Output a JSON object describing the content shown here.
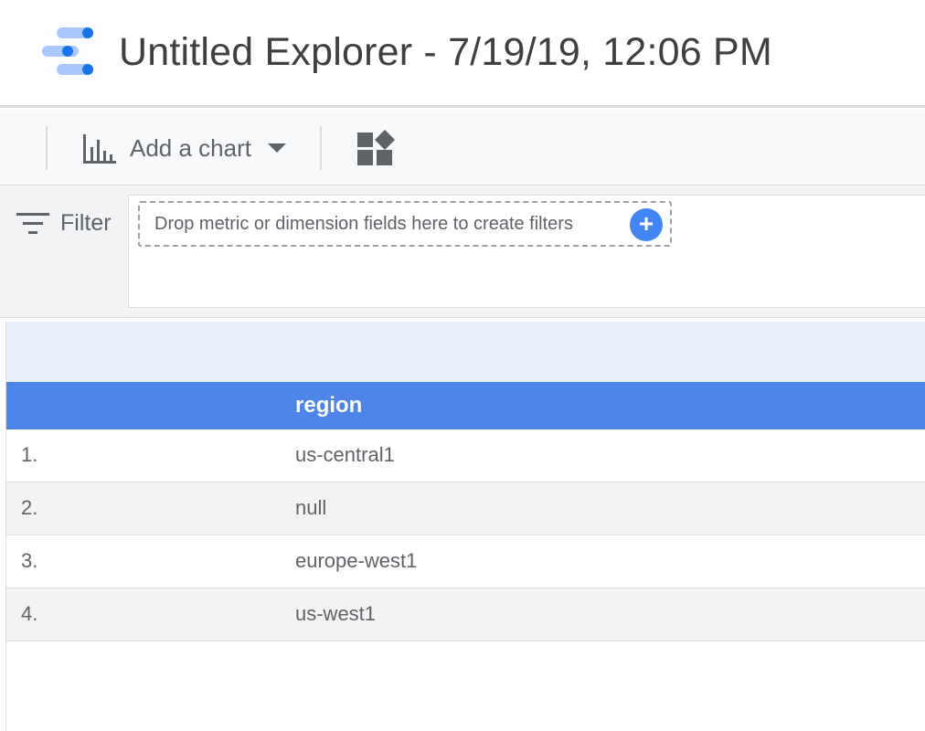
{
  "header": {
    "title": "Untitled Explorer - 7/19/19, 12:06 PM",
    "logo_icon": "data-studio-logo-icon"
  },
  "toolbar": {
    "add_chart_label": "Add a chart",
    "add_chart_icon": "bar-chart-icon",
    "components_icon": "community-components-icon"
  },
  "filter": {
    "label": "Filter",
    "drop_hint": "Drop metric or dimension fields here to create filters",
    "add_button_label": "+"
  },
  "table": {
    "columns": [
      "region"
    ],
    "rows": [
      {
        "index": "1.",
        "region": "us-central1"
      },
      {
        "index": "2.",
        "region": "null"
      },
      {
        "index": "3.",
        "region": "europe-west1"
      },
      {
        "index": "4.",
        "region": "us-west1"
      }
    ]
  },
  "colors": {
    "accent": "#4285f4",
    "table_header": "#4d86e8",
    "table_band": "#e8f0fd"
  }
}
